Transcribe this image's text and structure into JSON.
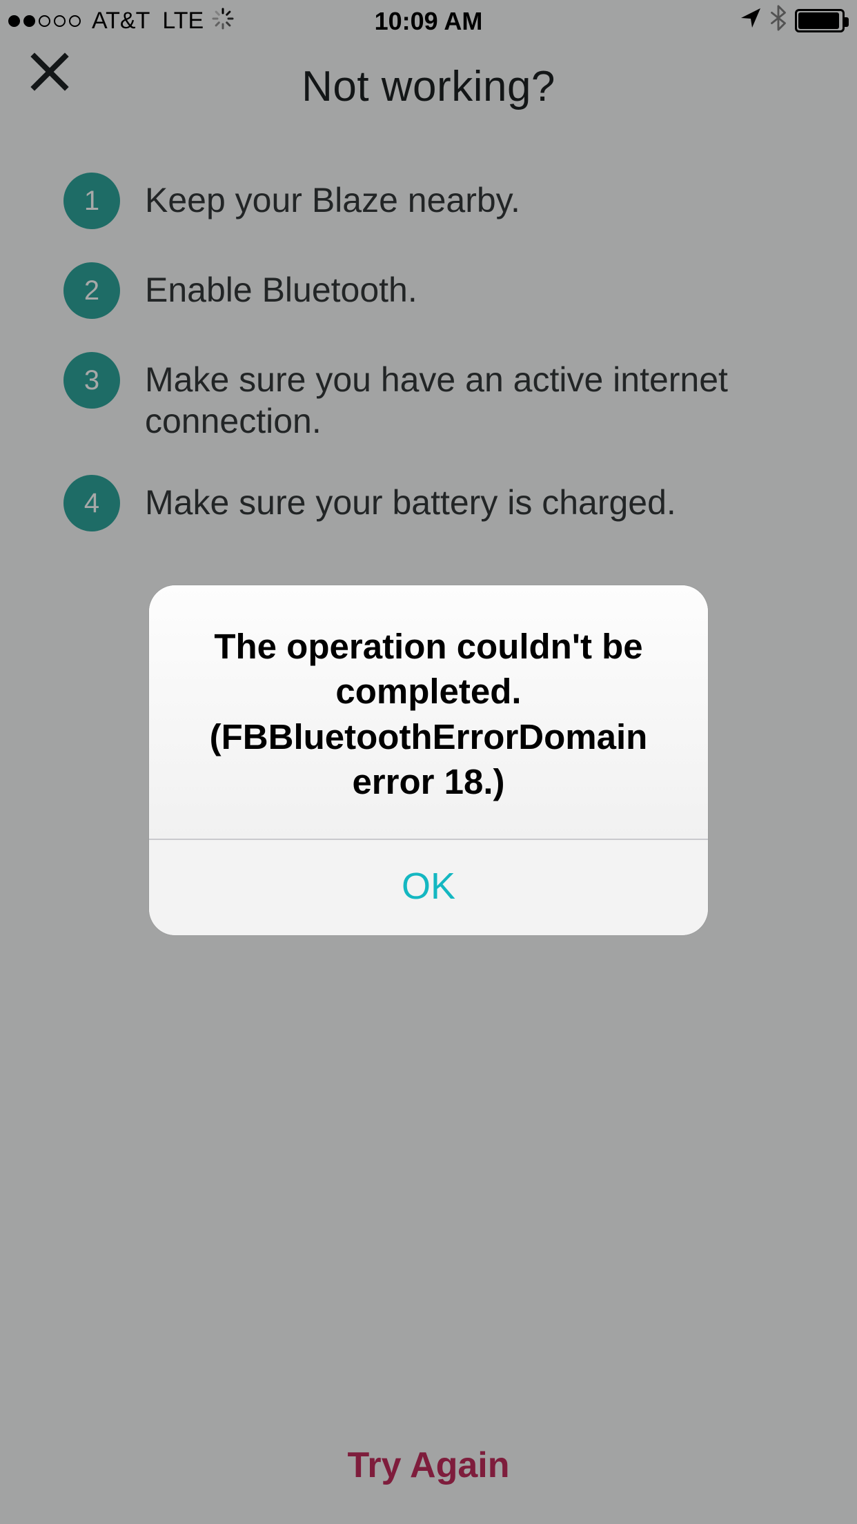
{
  "status": {
    "carrier": "AT&T",
    "network": "LTE",
    "time": "10:09 AM"
  },
  "header": {
    "title": "Not working?"
  },
  "steps": [
    {
      "num": "1",
      "text": "Keep your Blaze nearby."
    },
    {
      "num": "2",
      "text": "Enable Bluetooth."
    },
    {
      "num": "3",
      "text": "Make sure you have an active internet connection."
    },
    {
      "num": "4",
      "text": "Make sure your battery is charged."
    }
  ],
  "footer": {
    "try_again": "Try Again"
  },
  "alert": {
    "message": "The operation couldn't be completed. (FBBluetoothErrorDomain error 18.)",
    "ok": "OK"
  },
  "colors": {
    "accent_teal": "#2ea59b",
    "alert_action": "#14b7c1",
    "try_again": "#bf2d5b"
  }
}
